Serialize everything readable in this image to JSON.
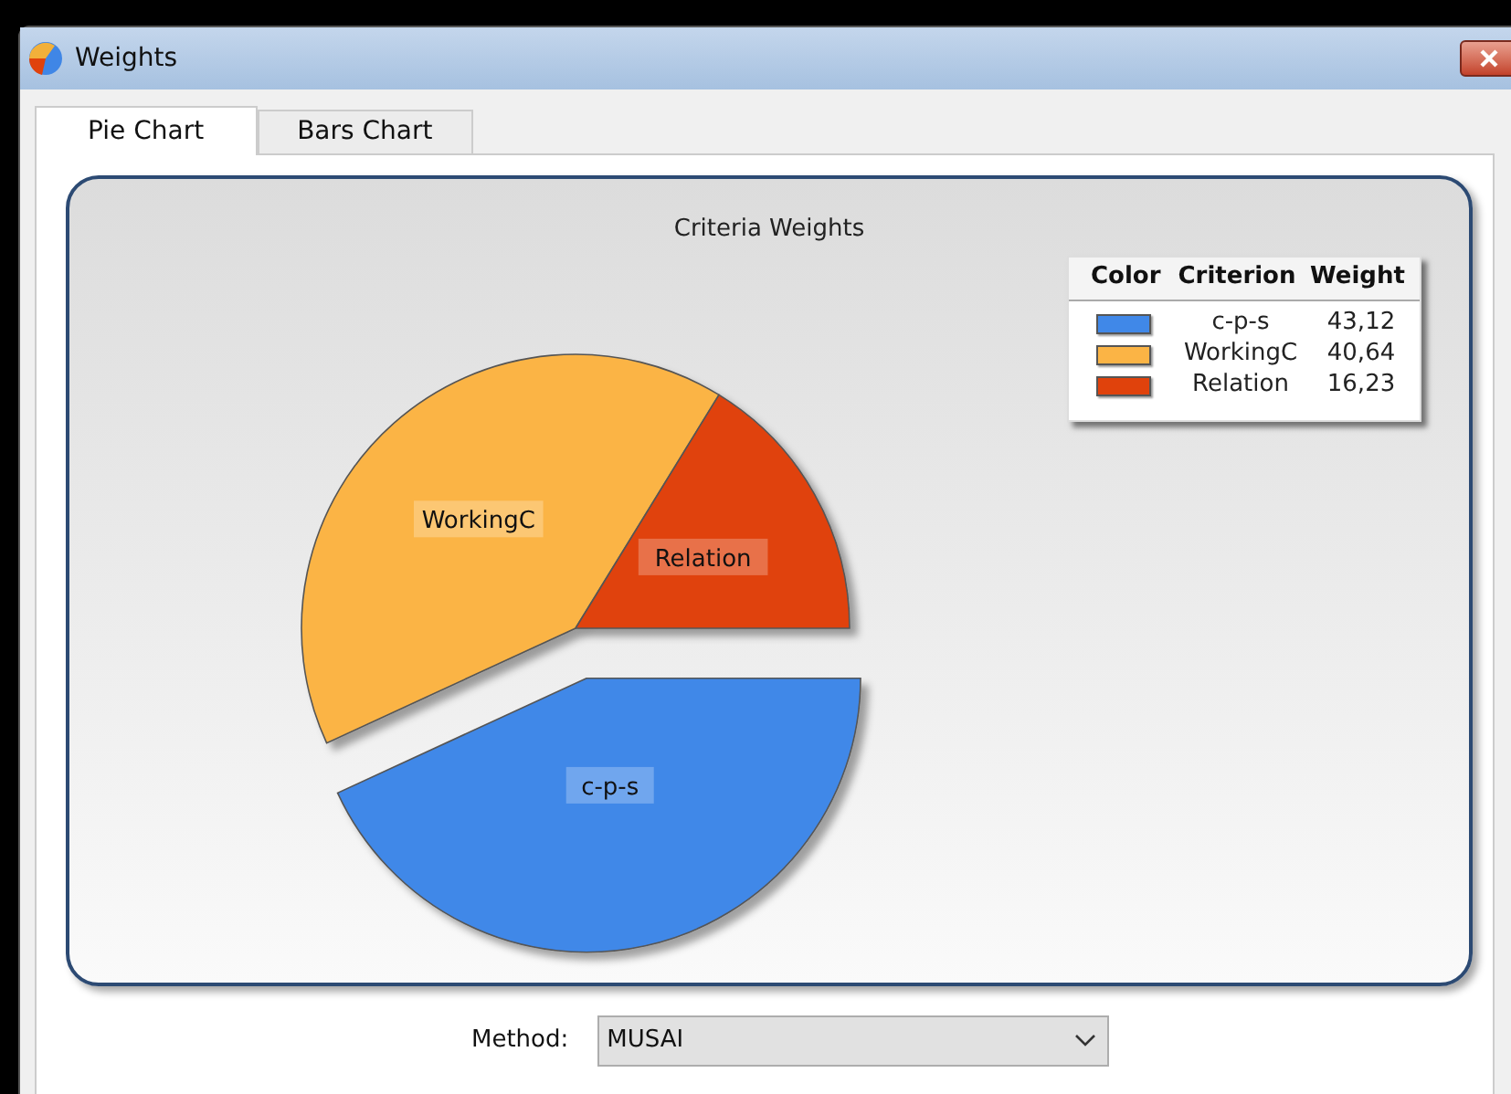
{
  "window": {
    "title": "Weights"
  },
  "tabs": [
    {
      "label": "Pie Chart",
      "selected": true
    },
    {
      "label": "Bars Chart",
      "selected": false
    }
  ],
  "chart": {
    "title": "Criteria Weights",
    "legend": {
      "columns": [
        "Color",
        "Criterion",
        "Weight"
      ],
      "items": [
        {
          "color": "#4088e8",
          "criterion": "c-p-s",
          "weight": "43,12"
        },
        {
          "color": "#fbb445",
          "criterion": "WorkingC",
          "weight": "40,64"
        },
        {
          "color": "#e0420c",
          "criterion": "Relation",
          "weight": "16,23"
        }
      ]
    },
    "chart_data": {
      "type": "pie",
      "categories": [
        "c-p-s",
        "WorkingC",
        "Relation"
      ],
      "series": [
        {
          "values": [
            43.12,
            40.64,
            16.23
          ]
        }
      ],
      "data_labels": "categories"
    }
  },
  "method": {
    "label": "Method:",
    "value": "MUSAI"
  }
}
